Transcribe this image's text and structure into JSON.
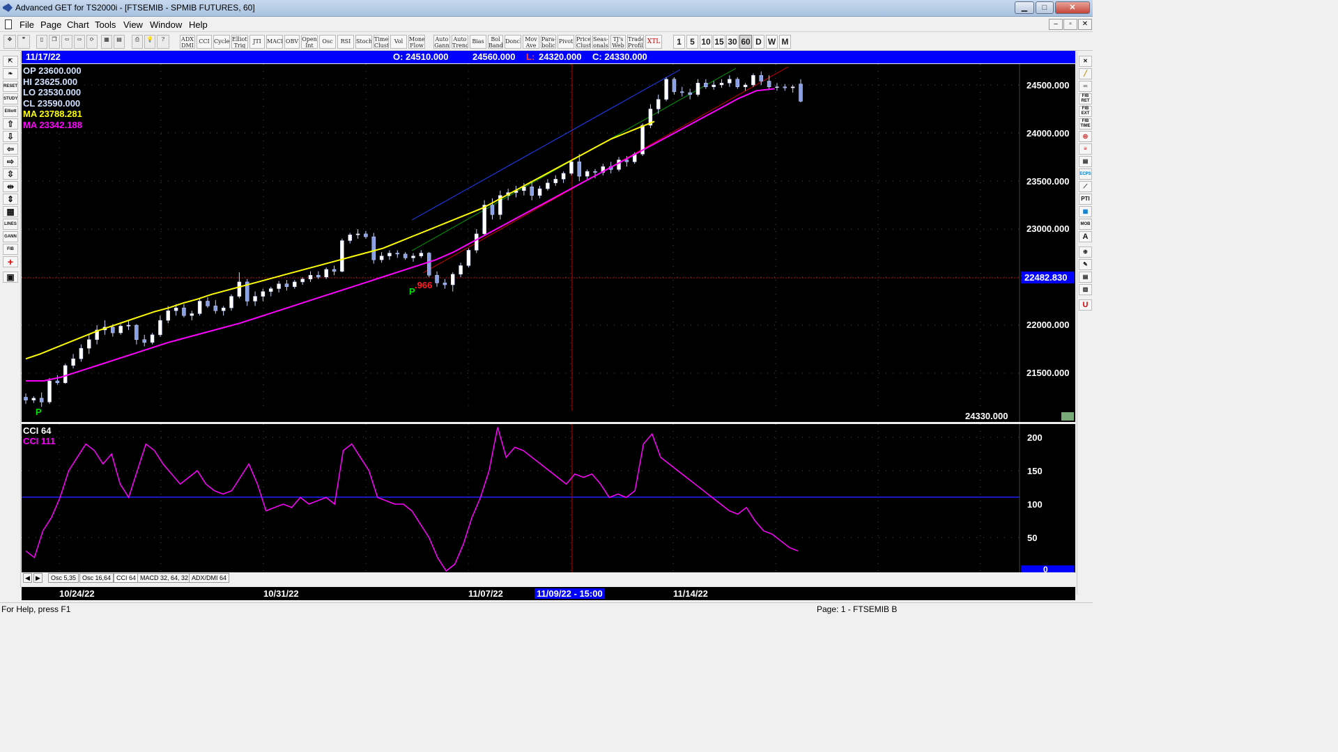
{
  "window": {
    "title": "Advanced GET for TS2000i - [FTSEMIB - SPMIB FUTURES, 60]",
    "buttons": {
      "minimize": "▁",
      "maximize": "□",
      "close": "✕"
    }
  },
  "menu": {
    "items": [
      "File",
      "Page",
      "Chart",
      "Tools",
      "View",
      "Window",
      "Help"
    ],
    "mdi": {
      "minimize": "–",
      "restore": "▫",
      "close": "✕"
    }
  },
  "toolbar": {
    "study_buttons": [
      "ADX DMI",
      "CCI",
      "Cycles",
      "Elliott Trig",
      "JTI",
      "MACD",
      "OBV",
      "Open Int",
      "Osc",
      "RSI",
      "Stoch",
      "Time Clust",
      "Vol",
      "Money Flow",
      "Auto Gann",
      "Auto Trend",
      "Bias",
      "Bol Band",
      "Donch",
      "Mov Ave",
      "Para-bolic",
      "Pivot",
      "Price Clust",
      "Seas-onals",
      "TJ's Web",
      "Trade Profile",
      "XTL"
    ],
    "timeframes": [
      "1",
      "5",
      "10",
      "15",
      "30",
      "60",
      "D",
      "W",
      "M"
    ],
    "active_timeframe": "60"
  },
  "left_tools": [
    "⇱",
    "❧",
    "RESET",
    "STUDY",
    "Elliott",
    "⇧",
    "⇩",
    "⇦",
    "⇨",
    "⇳",
    "⇹",
    "⇕",
    "▦",
    "LINES",
    "GANN",
    "FIB",
    "+",
    "▣"
  ],
  "right_tools": [
    "✕",
    "╱",
    "═",
    "FIB RET",
    "FIB EXT",
    "FIB TIME",
    "◎",
    "≡",
    "▤",
    "ECPS",
    "⟋",
    "PTI",
    "▦",
    "MOB",
    "A",
    "⊕",
    "✎",
    "▤",
    "▥",
    "U"
  ],
  "info_bar": {
    "date": "11/17/22",
    "open": "O: 24510.000",
    "high": "24560.000",
    "low_label": "L:",
    "low": "24320.000",
    "close": "C: 24330.000"
  },
  "ohlc_panel": {
    "op": "OP  23600.000",
    "hi": "HI   23625.000",
    "lo": "LO  23530.000",
    "cl": "CL  23590.000",
    "ma1": "MA  23788.281",
    "ma2": "MA  23342.188"
  },
  "price_axis": {
    "ticks": [
      "24500.000",
      "24000.000",
      "23500.000",
      "23000.000",
      "22000.000",
      "21500.000"
    ],
    "cursor_price": "22482.830",
    "last_price": "24330.000"
  },
  "annotations": {
    "pivot_label": "P",
    "ratio": ".966"
  },
  "cci_panel": {
    "title": "CCI 64",
    "value_label": "CCI  111",
    "ticks": [
      "200",
      "150",
      "100",
      "50"
    ],
    "zero_label": "0"
  },
  "tabs": [
    "Osc 5,35",
    "Osc 16,64",
    "CCI 64",
    "MACD 32, 64, 32",
    "ADX/DMI 64"
  ],
  "active_tab": "CCI 64",
  "dates": [
    "10/24/22",
    "10/31/22",
    "11/07/22",
    "11/14/22"
  ],
  "cursor_date": "11/09/22 - 15:00",
  "status": {
    "left": "For Help, press F1",
    "right": "Page: 1 - FTSEMIB B"
  },
  "colors": {
    "ma_fast": "#ffff00",
    "ma_slow": "#ff00ff",
    "cursor": "#ff0000",
    "info_bar": "#0000ff"
  },
  "chart_data": {
    "type": "candlestick",
    "ylim": [
      21100,
      24700
    ],
    "price_bars": [
      [
        21250,
        21290,
        21180,
        21220
      ],
      [
        21220,
        21260,
        21190,
        21240
      ],
      [
        21240,
        21300,
        21150,
        21200
      ],
      [
        21200,
        21450,
        21180,
        21420
      ],
      [
        21420,
        21480,
        21380,
        21400
      ],
      [
        21400,
        21600,
        21390,
        21580
      ],
      [
        21580,
        21700,
        21550,
        21650
      ],
      [
        21650,
        21800,
        21620,
        21760
      ],
      [
        21760,
        21900,
        21700,
        21850
      ],
      [
        21850,
        22000,
        21800,
        21950
      ],
      [
        21950,
        22050,
        21900,
        21980
      ],
      [
        21980,
        22010,
        21880,
        21920
      ],
      [
        21920,
        22010,
        21900,
        21990
      ],
      [
        21990,
        22050,
        21950,
        22000
      ],
      [
        22000,
        22010,
        21800,
        21850
      ],
      [
        21850,
        21900,
        21780,
        21820
      ],
      [
        21820,
        21920,
        21800,
        21900
      ],
      [
        21900,
        22100,
        21880,
        22050
      ],
      [
        22050,
        22200,
        22020,
        22150
      ],
      [
        22150,
        22220,
        22100,
        22180
      ],
      [
        22180,
        22220,
        22080,
        22100
      ],
      [
        22100,
        22150,
        22050,
        22120
      ],
      [
        22120,
        22280,
        22100,
        22250
      ],
      [
        22250,
        22290,
        22180,
        22200
      ],
      [
        22200,
        22260,
        22120,
        22150
      ],
      [
        22150,
        22200,
        22100,
        22180
      ],
      [
        22180,
        22320,
        22150,
        22300
      ],
      [
        22300,
        22550,
        22280,
        22450
      ],
      [
        22450,
        22480,
        22200,
        22250
      ],
      [
        22250,
        22350,
        22200,
        22300
      ],
      [
        22300,
        22380,
        22250,
        22350
      ],
      [
        22350,
        22400,
        22300,
        22380
      ],
      [
        22380,
        22460,
        22340,
        22430
      ],
      [
        22430,
        22470,
        22360,
        22400
      ],
      [
        22400,
        22470,
        22380,
        22450
      ],
      [
        22450,
        22500,
        22420,
        22480
      ],
      [
        22480,
        22560,
        22450,
        22520
      ],
      [
        22520,
        22560,
        22480,
        22500
      ],
      [
        22500,
        22600,
        22480,
        22580
      ],
      [
        22580,
        22620,
        22520,
        22560
      ],
      [
        22560,
        22900,
        22550,
        22880
      ],
      [
        22880,
        22960,
        22850,
        22940
      ],
      [
        22940,
        23000,
        22900,
        22950
      ],
      [
        22950,
        22980,
        22900,
        22920
      ],
      [
        22920,
        22960,
        22640,
        22680
      ],
      [
        22680,
        22760,
        22650,
        22720
      ],
      [
        22720,
        22780,
        22680,
        22750
      ],
      [
        22750,
        22780,
        22700,
        22740
      ],
      [
        22740,
        22760,
        22680,
        22700
      ],
      [
        22700,
        22750,
        22660,
        22720
      ],
      [
        22720,
        22780,
        22700,
        22750
      ],
      [
        22750,
        22760,
        22500,
        22520
      ],
      [
        22520,
        22560,
        22400,
        22440
      ],
      [
        22440,
        22480,
        22380,
        22420
      ],
      [
        22420,
        22550,
        22350,
        22530
      ],
      [
        22530,
        22650,
        22500,
        22620
      ],
      [
        22620,
        22800,
        22600,
        22780
      ],
      [
        22780,
        23000,
        22750,
        22950
      ],
      [
        22950,
        23300,
        22930,
        23250
      ],
      [
        23250,
        23320,
        23100,
        23150
      ],
      [
        23150,
        23400,
        23100,
        23350
      ],
      [
        23350,
        23420,
        23300,
        23380
      ],
      [
        23380,
        23450,
        23330,
        23400
      ],
      [
        23400,
        23480,
        23350,
        23440
      ],
      [
        23440,
        23500,
        23300,
        23350
      ],
      [
        23350,
        23450,
        23320,
        23420
      ],
      [
        23420,
        23520,
        23400,
        23480
      ],
      [
        23480,
        23560,
        23450,
        23520
      ],
      [
        23520,
        23600,
        23480,
        23580
      ],
      [
        23580,
        23720,
        23560,
        23700
      ],
      [
        23700,
        23780,
        23500,
        23550
      ],
      [
        23550,
        23620,
        23520,
        23600
      ],
      [
        23600,
        23625,
        23530,
        23590
      ],
      [
        23590,
        23680,
        23560,
        23650
      ],
      [
        23650,
        23700,
        23580,
        23620
      ],
      [
        23620,
        23750,
        23600,
        23720
      ],
      [
        23720,
        23760,
        23650,
        23700
      ],
      [
        23700,
        23800,
        23680,
        23780
      ],
      [
        23780,
        24100,
        23760,
        24080
      ],
      [
        24080,
        24300,
        24050,
        24250
      ],
      [
        24250,
        24400,
        24200,
        24350
      ],
      [
        24350,
        24580,
        24330,
        24560
      ],
      [
        24560,
        24580,
        24400,
        24430
      ],
      [
        24430,
        24480,
        24380,
        24420
      ],
      [
        24420,
        24460,
        24350,
        24400
      ],
      [
        24400,
        24560,
        24380,
        24520
      ],
      [
        24520,
        24560,
        24460,
        24480
      ],
      [
        24480,
        24540,
        24450,
        24500
      ],
      [
        24500,
        24560,
        24470,
        24520
      ],
      [
        24520,
        24600,
        24480,
        24560
      ],
      [
        24560,
        24580,
        24460,
        24480
      ],
      [
        24480,
        24520,
        24440,
        24500
      ],
      [
        24500,
        24620,
        24480,
        24600
      ],
      [
        24600,
        24640,
        24500,
        24540
      ],
      [
        24540,
        24600,
        24460,
        24480
      ],
      [
        24480,
        24520,
        24440,
        24480
      ],
      [
        24480,
        24510,
        24440,
        24470
      ],
      [
        24470,
        24500,
        24420,
        24480
      ],
      [
        24510,
        24560,
        24320,
        24330
      ]
    ],
    "ma_fast_values": [
      21650,
      21700,
      21760,
      21820,
      21880,
      21940,
      21990,
      22040,
      22090,
      22140,
      22180,
      22230,
      22270,
      22320,
      22360,
      22400,
      22440,
      22480,
      22520,
      22560,
      22600,
      22640,
      22680,
      22720,
      22760,
      22800,
      22860,
      22920,
      22980,
      23040,
      23100,
      23160,
      23220,
      23300,
      23380,
      23460,
      23540,
      23620,
      23700,
      23780,
      23860,
      23940,
      24000,
      24060,
      24120
    ],
    "ma_slow_values": [
      21420,
      21420,
      21460,
      21520,
      21580,
      21640,
      21700,
      21760,
      21820,
      21870,
      21920,
      21970,
      22020,
      22080,
      22140,
      22200,
      22260,
      22320,
      22380,
      22440,
      22500,
      22560,
      22620,
      22680,
      22760,
      22860,
      22960,
      23060,
      23160,
      23260,
      23360,
      23460,
      23560,
      23660,
      23760,
      23860,
      23960,
      24060,
      24160,
      24260,
      24360,
      24440,
      24460
    ],
    "cci_values": [
      30,
      20,
      60,
      80,
      110,
      150,
      170,
      190,
      180,
      160,
      175,
      130,
      110,
      150,
      190,
      180,
      160,
      145,
      130,
      140,
      150,
      130,
      120,
      115,
      120,
      140,
      160,
      130,
      90,
      95,
      100,
      95,
      110,
      100,
      105,
      110,
      100,
      180,
      190,
      170,
      150,
      110,
      105,
      100,
      100,
      90,
      70,
      50,
      20,
      0,
      10,
      40,
      80,
      110,
      150,
      215,
      170,
      185,
      180,
      170,
      160,
      150,
      140,
      130,
      145,
      140,
      145,
      130,
      110,
      115,
      110,
      120,
      190,
      205,
      170,
      160,
      150,
      140,
      130,
      120,
      110,
      100,
      90,
      85,
      95,
      75,
      60,
      55,
      45,
      35,
      30
    ],
    "cci_ylim": [
      0,
      220
    ]
  }
}
